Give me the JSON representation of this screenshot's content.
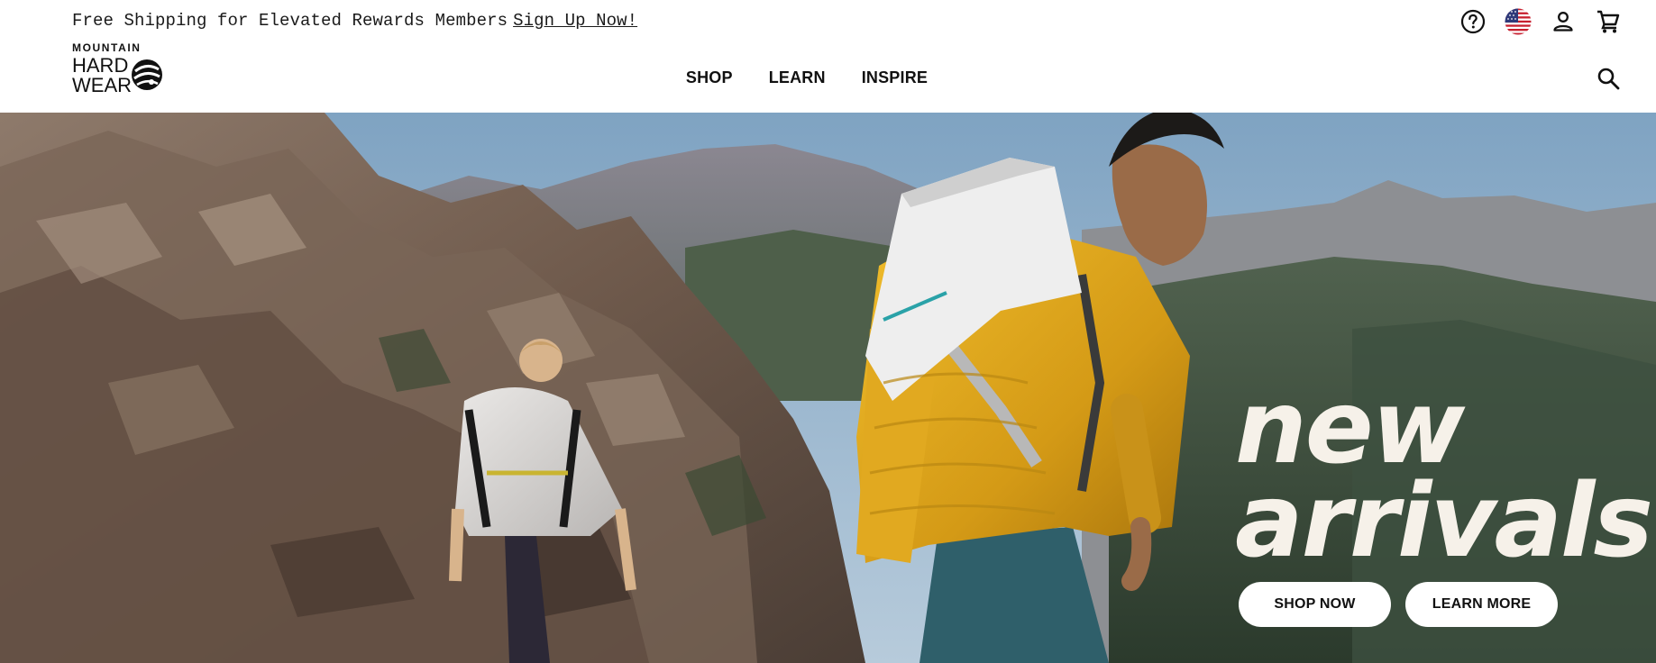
{
  "promo": {
    "text": "Free Shipping for Elevated Rewards Members",
    "link_label": "Sign Up Now!"
  },
  "brand": {
    "logo_lines": [
      "MOUNTAIN",
      "HARD",
      "WEAR"
    ],
    "logo_alt": "Mountain Hardwear"
  },
  "utility_icons": [
    "help-icon",
    "us-flag-icon",
    "account-icon",
    "cart-icon"
  ],
  "nav": {
    "items": [
      "SHOP",
      "LEARN",
      "INSPIRE"
    ]
  },
  "hero": {
    "headline_line1": "new",
    "headline_line2": "arrivals",
    "shop_label": "SHOP NOW",
    "learn_label": "LEARN MORE"
  },
  "colors": {
    "headline": "#f6f1e9",
    "jacket": "#e0a820",
    "sky": "#8fb0cc"
  }
}
